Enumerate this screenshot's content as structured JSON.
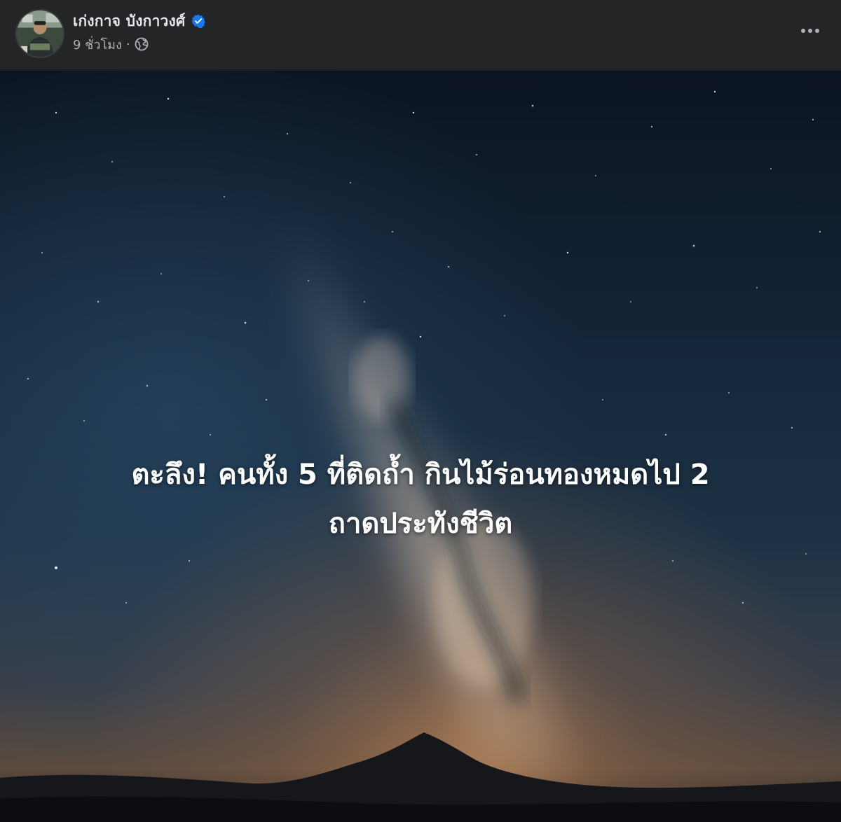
{
  "post": {
    "author_name": "เก่งกาจ บังกาวงศ์",
    "verified": true,
    "timestamp": "9 ชั่วโมง",
    "separator": "·",
    "privacy_icon": "globe-icon",
    "more_icon": "more-options-icon"
  },
  "image": {
    "headline_line1": "ตะลึง! คนทั้ง 5 ที่ติดถ้ำ กินไม้ร่อนทองหมดไป 2",
    "headline_line2": "ถาดประทังชีวิต"
  },
  "colors": {
    "header_bg": "#242526",
    "name_text": "#e4e6eb",
    "meta_text": "#b0b3b8",
    "verified_blue": "#1877f2",
    "headline_text": "#ffffff"
  }
}
